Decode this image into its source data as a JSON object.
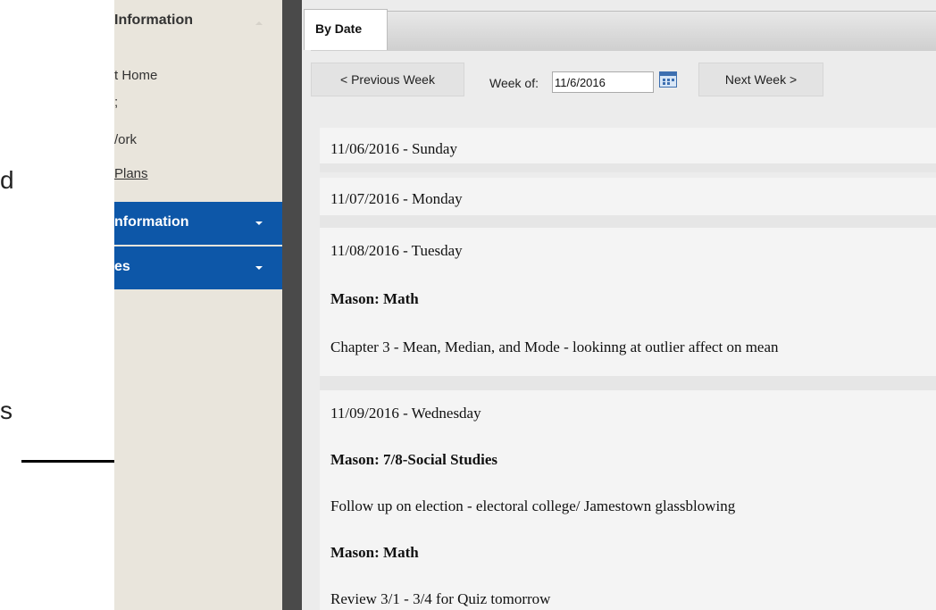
{
  "margin": {
    "letters": [
      "d",
      "s"
    ]
  },
  "sidebar": {
    "header": "Information",
    "links": [
      "t Home",
      ";",
      "/ork",
      " Plans"
    ],
    "sections": [
      "nformation",
      "es"
    ]
  },
  "main": {
    "tab_label": "By Date",
    "prev_label": "< Previous Week",
    "week_of_label": "Week of:",
    "week_value": "11/6/2016",
    "next_label": "Next Week >",
    "rows": [
      "11/06/2016 - Sunday",
      "11/07/2016 - Monday",
      "11/08/2016 - Tuesday",
      "Mason: Math",
      "Chapter 3 -  Mean, Median, and Mode  - lookinng at outlier affect on mean",
      "11/09/2016 - Wednesday",
      "Mason: 7/8-Social Studies",
      "Follow up on election - electoral college/ Jamestown glassblowing",
      "Mason: Math",
      "Review 3/1 - 3/4  for Quiz tomorrow"
    ]
  },
  "colors": {
    "sidebar_bg": "#e9e5dc",
    "sidebar_blue": "#0d57a8",
    "divider": "#4a4a4a",
    "main_bg": "#ececec"
  }
}
